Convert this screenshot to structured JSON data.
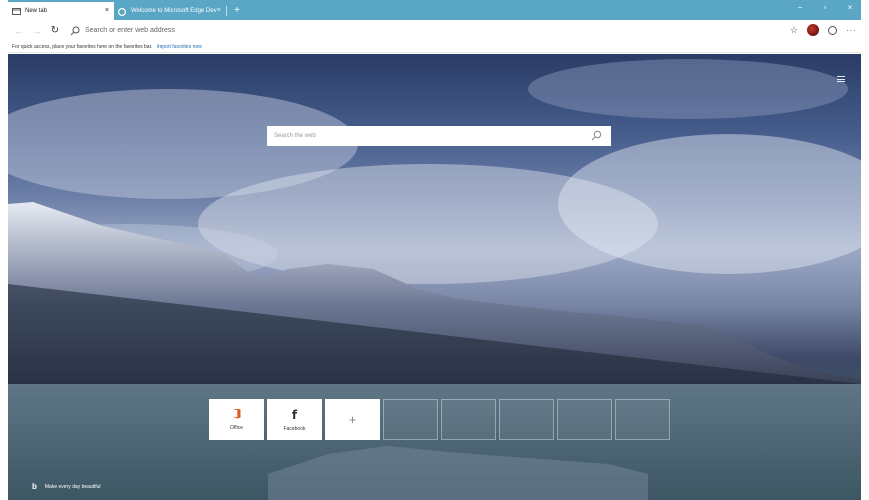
{
  "tabs": [
    {
      "label": "New tab",
      "active": true
    },
    {
      "label": "Welcome to Microsoft Edge Dev",
      "active": false
    }
  ],
  "tab_strip": {
    "new_tab_label": "+"
  },
  "window_controls": {
    "minimize": "−",
    "maximize": "▫",
    "close": "×"
  },
  "address_bar": {
    "placeholder": "Search or enter web address"
  },
  "favorites_hint": {
    "text": "For quick access, place your favorites here on the favorites bar.",
    "link": "Import favorites now"
  },
  "search": {
    "placeholder": "Search the web"
  },
  "tiles": [
    {
      "label": "Office",
      "icon": "office-icon"
    },
    {
      "label": "Facebook",
      "icon": "facebook-icon",
      "glyph": "f"
    },
    {
      "label": "",
      "icon": "add-icon",
      "glyph": "+"
    }
  ],
  "empty_tile_count": 5,
  "footer": {
    "text": "Make every day beautiful",
    "icon": "b"
  },
  "colors": {
    "tab_strip": "#5aa6c5",
    "accent": "#1a6fb7"
  }
}
